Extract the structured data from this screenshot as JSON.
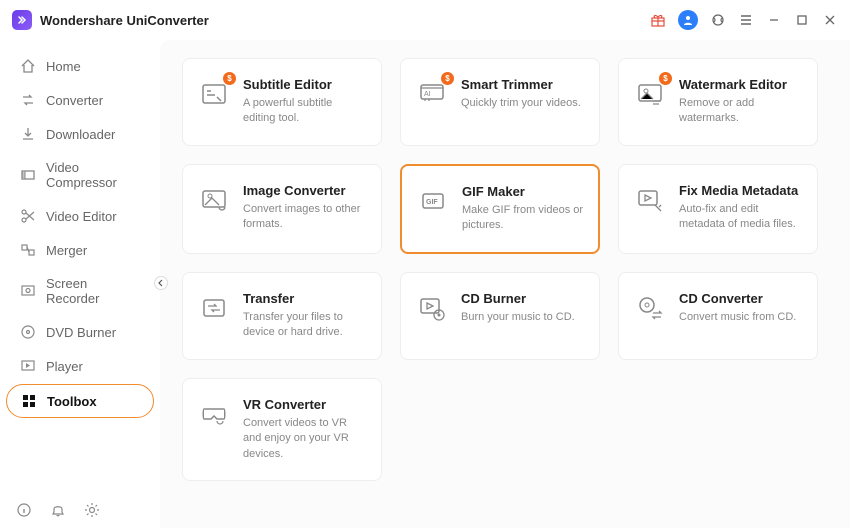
{
  "app": {
    "title": "Wondershare UniConverter"
  },
  "sidebar": {
    "items": [
      {
        "label": "Home"
      },
      {
        "label": "Converter"
      },
      {
        "label": "Downloader"
      },
      {
        "label": "Video Compressor"
      },
      {
        "label": "Video Editor"
      },
      {
        "label": "Merger"
      },
      {
        "label": "Screen Recorder"
      },
      {
        "label": "DVD Burner"
      },
      {
        "label": "Player"
      },
      {
        "label": "Toolbox"
      }
    ]
  },
  "tools": [
    {
      "title": "Subtitle Editor",
      "desc": "A powerful subtitle editing tool.",
      "badge": "$"
    },
    {
      "title": "Smart Trimmer",
      "desc": "Quickly trim your videos.",
      "badge": "$"
    },
    {
      "title": "Watermark Editor",
      "desc": "Remove or add watermarks.",
      "badge": "$"
    },
    {
      "title": "Image Converter",
      "desc": "Convert images to other formats."
    },
    {
      "title": "GIF Maker",
      "desc": "Make GIF from videos or pictures."
    },
    {
      "title": "Fix Media Metadata",
      "desc": "Auto-fix and edit metadata of media files."
    },
    {
      "title": "Transfer",
      "desc": "Transfer your files to device or hard drive."
    },
    {
      "title": "CD Burner",
      "desc": "Burn your music to CD."
    },
    {
      "title": "CD Converter",
      "desc": "Convert music from CD."
    },
    {
      "title": "VR Converter",
      "desc": "Convert videos to VR and enjoy on your VR devices."
    }
  ]
}
